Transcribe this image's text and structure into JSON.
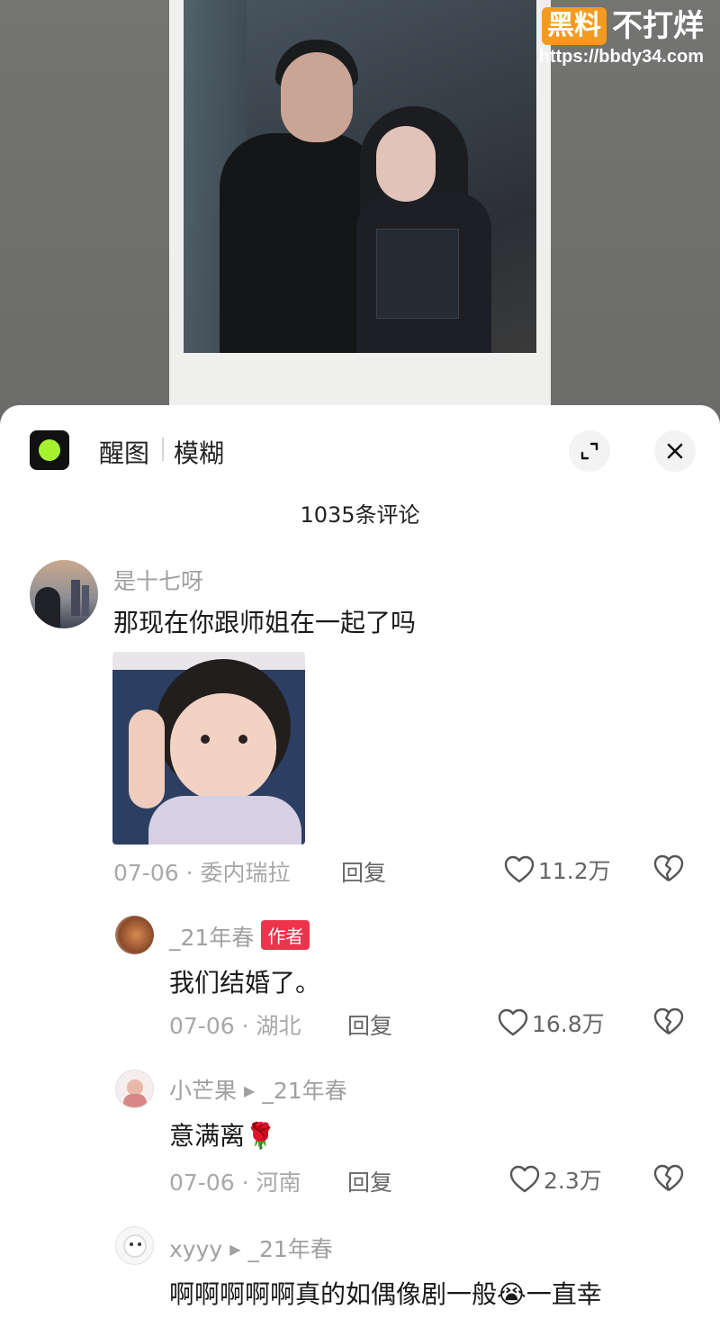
{
  "watermark": {
    "tag": "黑料",
    "brand": "不打烊",
    "url": "https://bbdy34.com"
  },
  "header": {
    "app_name": "醒图",
    "app_sub": "模糊",
    "comment_count": "1035条评论"
  },
  "comments": [
    {
      "username": "是十七呀",
      "text": "那现在你跟师姐在一起了吗",
      "meta": "07-06 · 委内瑞拉",
      "reply_label": "回复",
      "likes": "11.2万"
    },
    {
      "username": "_21年春",
      "badge": "作者",
      "text": "我们结婚了。",
      "meta": "07-06 · 湖北",
      "reply_label": "回复",
      "likes": "16.8万"
    },
    {
      "username": "小芒果",
      "reply_to": "_21年春",
      "text": "意满离🌹",
      "meta": "07-06 · 河南",
      "reply_label": "回复",
      "likes": "2.3万"
    },
    {
      "username": "xyyy",
      "reply_to": "_21年春",
      "text": "啊啊啊啊啊真的如偶像剧一般😭一直幸"
    }
  ],
  "icons": {
    "expand": "expand-icon",
    "close": "close-icon",
    "like": "heart-icon",
    "dislike": "broken-heart-icon",
    "reply_arrow": "play-arrow-icon"
  },
  "colors": {
    "author_badge": "#f0334d",
    "watermark_tag": "#f39a21",
    "app_icon_dot": "#a6f22f"
  }
}
